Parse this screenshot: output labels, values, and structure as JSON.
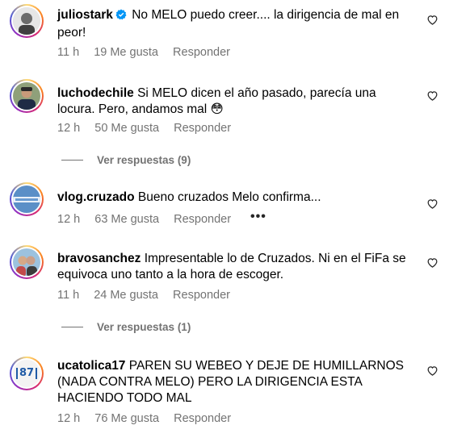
{
  "comments": [
    {
      "username": "juliostark",
      "verified": true,
      "text": "No MELO puedo creer.... la dirigencia de mal en peor!",
      "time": "11 h",
      "likes": "19 Me gusta",
      "reply": "Responder"
    },
    {
      "username": "luchodechile",
      "text": "Si MELO dicen el año pasado, parecía una locura. Pero, andamos mal 😳",
      "time": "12 h",
      "likes": "50 Me gusta",
      "reply": "Responder",
      "view_replies": "Ver respuestas (9)"
    },
    {
      "username": "vlog.cruzado",
      "text": "Bueno cruzados Melo confirma...",
      "time": "12 h",
      "likes": "63 Me gusta",
      "reply": "Responder",
      "more": "•••"
    },
    {
      "username": "bravosanchez",
      "text": "Impresentable lo de Cruzados. Ni en el FiFa se equivoca uno tanto a la hora de escoger.",
      "time": "11 h",
      "likes": "24 Me gusta",
      "reply": "Responder",
      "view_replies": "Ver respuestas (1)"
    },
    {
      "username": "ucatolica17",
      "text": "PAREN SU WEBEO Y DEJE DE HUMILLARNOS (NADA CONTRA MELO) PERO LA DIRIGENCIA ESTA HACIENDO TODO MAL",
      "time": "12 h",
      "likes": "76 Me gusta",
      "reply": "Responder",
      "avatar_text": "87"
    }
  ],
  "icons": {
    "like": "heart-outline-icon",
    "verified": "verified-badge-icon"
  },
  "colors": {
    "secondary_text": "#737373",
    "verified_blue": "#0095f6"
  }
}
